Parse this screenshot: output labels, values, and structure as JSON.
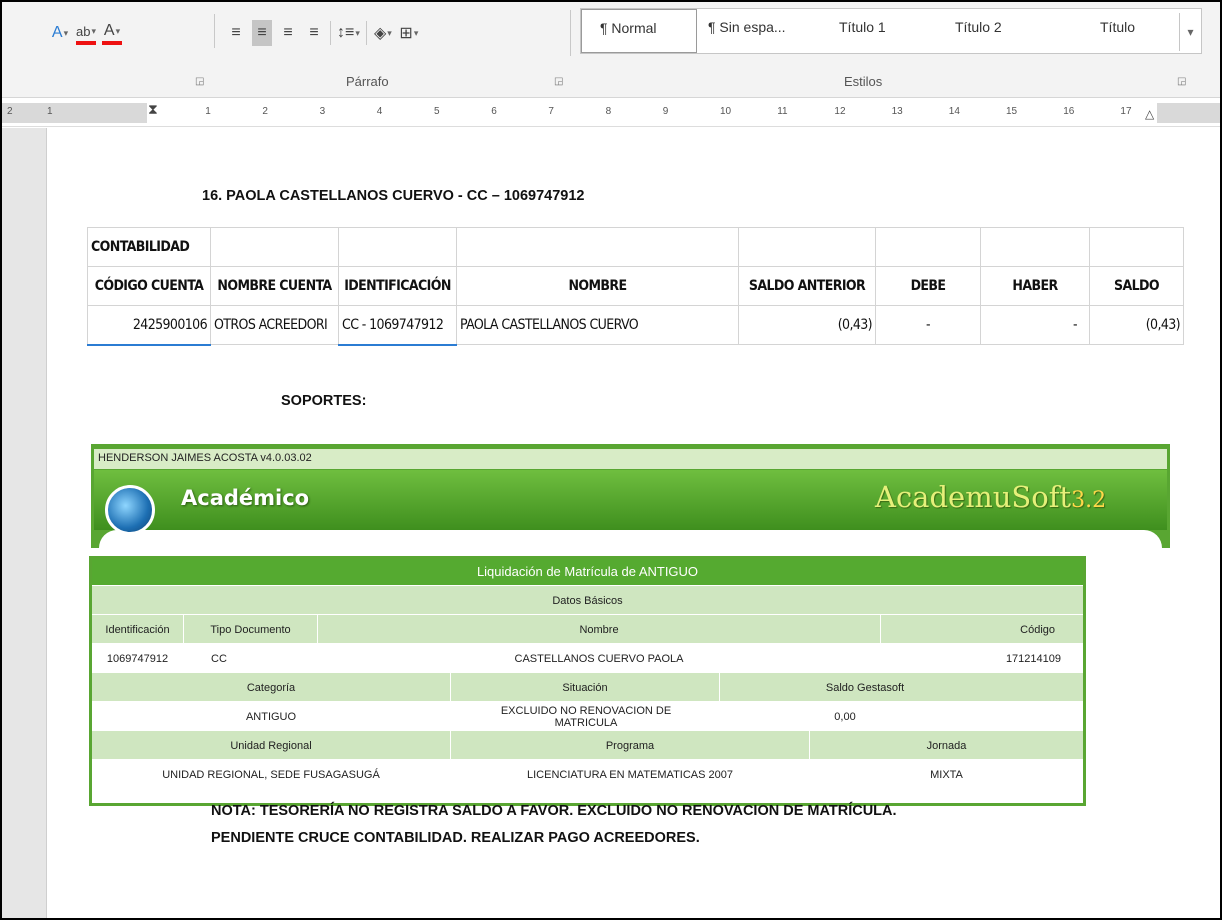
{
  "ribbon": {
    "paragraph_label": "Párrafo",
    "styles_label": "Estilos",
    "styles": [
      "¶ Normal",
      "¶ Sin espa...",
      "Título 1",
      "Título 2",
      "Título"
    ]
  },
  "ruler": {
    "marks": [
      "2",
      "1",
      "1",
      "2",
      "3",
      "4",
      "5",
      "6",
      "7",
      "8",
      "9",
      "10",
      "11",
      "12",
      "13",
      "14",
      "15",
      "16",
      "17"
    ]
  },
  "document": {
    "heading": "16.  PAOLA  CASTELLANOS CUERVO - CC – 1069747912",
    "ledger": {
      "section": "CONTABILIDAD",
      "headers": [
        "CÓDIGO CUENTA",
        "NOMBRE CUENTA",
        "IDENTIFICACIÓN",
        "NOMBRE",
        "SALDO ANTERIOR",
        "DEBE",
        "HABER",
        "SALDO"
      ],
      "row": [
        "2425900106",
        "OTROS ACREEDORI",
        "CC - 1069747912",
        "PAOLA  CASTELLANOS CUERVO",
        "(0,43)",
        "-",
        "-",
        "(0,43)"
      ]
    },
    "soportes": "SOPORTES:",
    "nota_line1": "NOTA: TESORERÍA NO REGISTRA SALDO A FAVOR. EXCLUIDO NO RENOVACION DE MATRÍCULA.",
    "nota_line2": "PENDIENTE CRUCE CONTABILIDAD. REALIZAR PAGO ACREEDORES."
  },
  "academusoft": {
    "title_bar": "HENDERSON JAIMES ACOSTA v4.0.03.02",
    "module": "Académico",
    "brand": "AcademuSoft",
    "brand_version": "3.2",
    "liquidacion": {
      "title": "Liquidación de Matrícula de ANTIGUO",
      "section": "Datos Básicos",
      "col_identificacion": "Identificación",
      "col_tipo": "Tipo Documento",
      "col_nombre": "Nombre",
      "col_codigo": "Código",
      "identificacion": "1069747912",
      "tipo": "CC",
      "nombre": "CASTELLANOS CUERVO PAOLA",
      "codigo": "171214109",
      "col_categoria": "Categoría",
      "col_situacion": "Situación",
      "col_saldo": "Saldo Gestasoft",
      "categoria": "ANTIGUO",
      "situacion": "EXCLUIDO NO RENOVACION DE MATRICULA",
      "saldo": "0,00",
      "col_unidad": "Unidad Regional",
      "col_programa": "Programa",
      "col_jornada": "Jornada",
      "unidad": "UNIDAD REGIONAL, SEDE FUSAGASUGÁ",
      "programa": "LICENCIATURA EN MATEMATICAS 2007",
      "jornada": "MIXTA"
    }
  },
  "colors": {
    "ribbon_bg": "#f3f3f3",
    "academusoft_green": "#59a632",
    "row_green": "#cfe6c0"
  }
}
